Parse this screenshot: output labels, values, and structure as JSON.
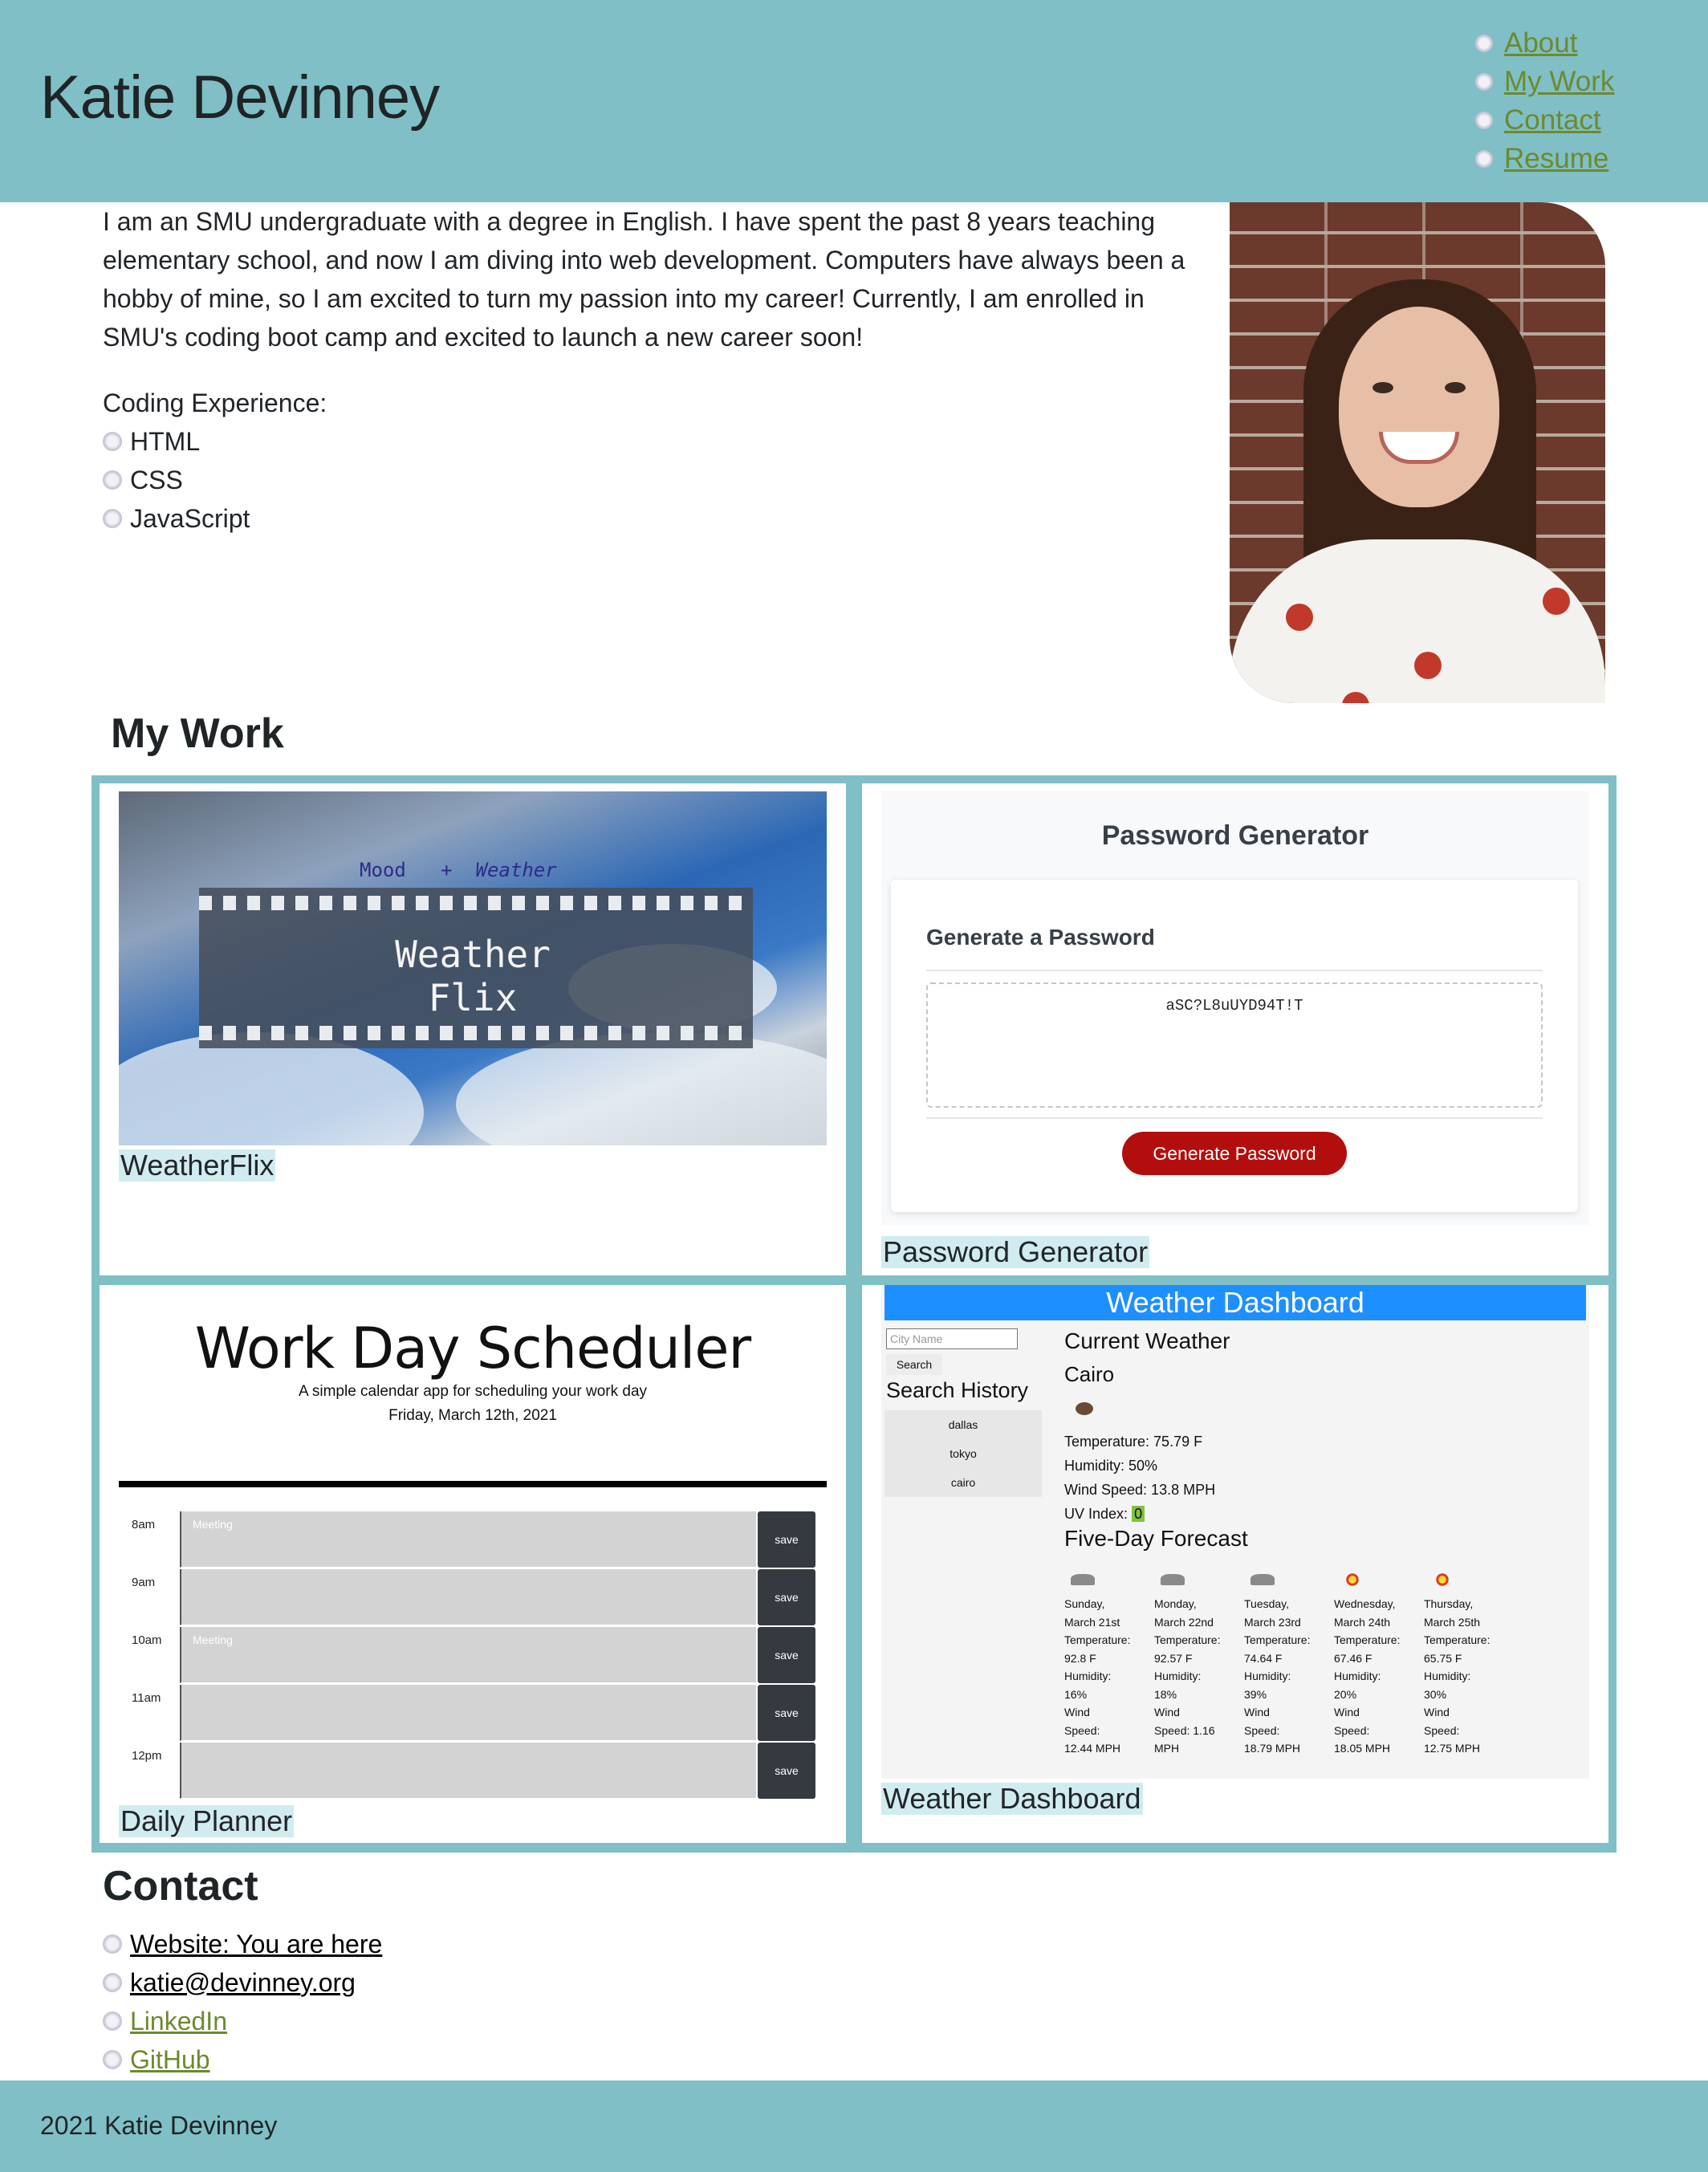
{
  "header": {
    "title": "Katie Devinney",
    "nav": [
      "About",
      "My Work",
      "Contact",
      "Resume"
    ]
  },
  "about": {
    "bio": "I am an SMU undergraduate with a degree in English. I have spent the past 8 years teaching elementary school, and now I am diving into web development. Computers have always been a hobby of mine, so I am excited to turn my passion into my career! Currently, I am enrolled in SMU's coding boot camp and excited to launch a new career soon!",
    "experience_label": "Coding Experience:",
    "experience": [
      "HTML",
      "CSS",
      "JavaScript"
    ]
  },
  "work": {
    "title": "My Work",
    "projects": [
      {
        "caption": "WeatherFlix",
        "preview": {
          "mood": "Mood",
          "plus": "+",
          "weather": "Weather",
          "name_line1": "Weather",
          "name_line2": "Flix"
        }
      },
      {
        "caption": "Password Generator",
        "preview": {
          "title": "Password Generator",
          "heading": "Generate a Password",
          "password": "aSC?L8uUYD94T!T",
          "button": "Generate Password"
        }
      },
      {
        "caption": "Daily Planner",
        "preview": {
          "title": "Work Day Scheduler",
          "subtitle": "A simple calendar app for scheduling your work day",
          "date": "Friday, March 12th, 2021",
          "save": "save",
          "rows": [
            {
              "hour": "8am",
              "event": "Meeting"
            },
            {
              "hour": "9am",
              "event": ""
            },
            {
              "hour": "10am",
              "event": "Meeting"
            },
            {
              "hour": "11am",
              "event": ""
            },
            {
              "hour": "12pm",
              "event": ""
            }
          ]
        }
      },
      {
        "caption": "Weather Dashboard",
        "preview": {
          "title": "Weather Dashboard",
          "city_placeholder": "City Name",
          "search": "Search",
          "history_label": "Search History",
          "history": [
            "dallas",
            "tokyo",
            "cairo"
          ],
          "current_label": "Current Weather",
          "city": "Cairo",
          "temperature": "Temperature: 75.79 F",
          "humidity": "Humidity: 50%",
          "wind": "Wind Speed: 13.8 MPH",
          "uv_label": "UV Index:",
          "uv_value": "0",
          "forecast_label": "Five-Day Forecast",
          "forecast": [
            {
              "icon": "cloud-icon",
              "line1": "Sunday,",
              "line2": "March 21st",
              "line3": "Temperature:",
              "line4": "92.8 F",
              "line5": "Humidity:",
              "line6": "16%",
              "line7": "Wind",
              "line8": "Speed:",
              "line9": "12.44 MPH"
            },
            {
              "icon": "cloud-icon",
              "line1": "Monday,",
              "line2": "March 22nd",
              "line3": "Temperature:",
              "line4": "92.57 F",
              "line5": "Humidity:",
              "line6": "18%",
              "line7": "Wind",
              "line8": "Speed: 1.16",
              "line9": "MPH"
            },
            {
              "icon": "cloud-icon",
              "line1": "Tuesday,",
              "line2": "March 23rd",
              "line3": "Temperature:",
              "line4": "74.64 F",
              "line5": "Humidity:",
              "line6": "39%",
              "line7": "Wind",
              "line8": "Speed:",
              "line9": "18.79 MPH"
            },
            {
              "icon": "sun-icon",
              "line1": "Wednesday,",
              "line2": "March 24th",
              "line3": "Temperature:",
              "line4": "67.46 F",
              "line5": "Humidity:",
              "line6": "20%",
              "line7": "Wind",
              "line8": "Speed:",
              "line9": "18.05 MPH"
            },
            {
              "icon": "sun-icon",
              "line1": "Thursday,",
              "line2": "March 25th",
              "line3": "Temperature:",
              "line4": "65.75 F",
              "line5": "Humidity:",
              "line6": "30%",
              "line7": "Wind",
              "line8": "Speed:",
              "line9": "12.75 MPH"
            }
          ]
        }
      }
    ]
  },
  "contact": {
    "title": "Contact",
    "links": [
      "Website: You are here",
      "katie@devinney.org",
      "LinkedIn",
      "GitHub"
    ]
  },
  "footer": {
    "text": "2021 Katie Devinney"
  },
  "colors": {
    "header_bg": "#80bfc6",
    "link_green": "#6c8a2f",
    "caption_bg": "#d1ecf1",
    "pw_button": "#b30e0e",
    "wd_banner": "#1e8fff"
  }
}
